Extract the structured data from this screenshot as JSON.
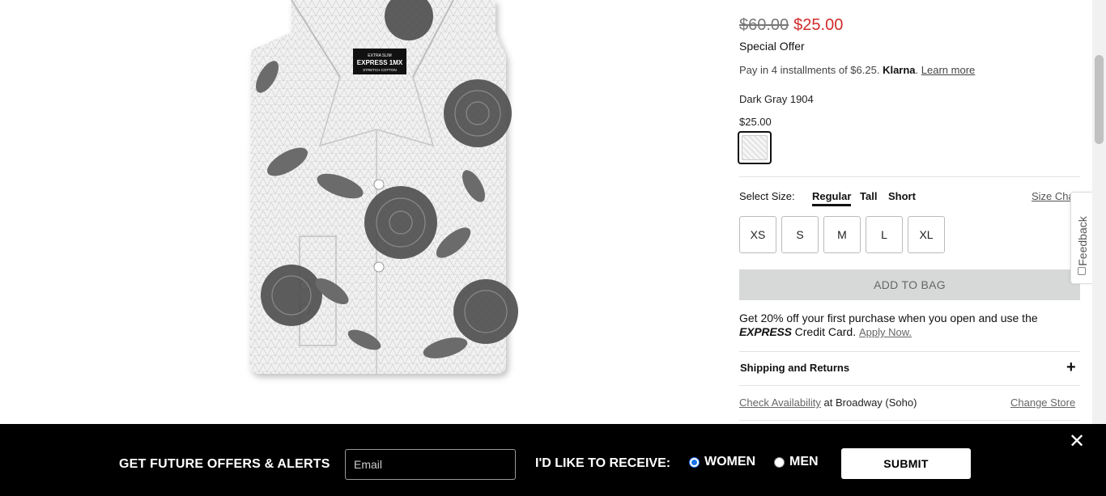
{
  "product": {
    "image_alt": "Extra Slim Floral Print Stretch Cotton 1MX Shirt",
    "label_line1": "EXTRA SLIM",
    "label_brand": "EXPRESS 1MX",
    "label_line3": "STRETCH COTTON"
  },
  "pricing": {
    "original": "$60.00",
    "sale": "$25.00",
    "special": "Special Offer",
    "klarna_prefix": "Pay in 4 installments of $6.25.",
    "klarna_brand": "Klarna",
    "klarna_period": ".",
    "klarna_link": "Learn more"
  },
  "color": {
    "name": "Dark Gray 1904",
    "price": "$25.00"
  },
  "size": {
    "label": "Select Size:",
    "fits": [
      "Regular",
      "Tall",
      "Short"
    ],
    "chart_link": "Size Chart",
    "options": [
      "XS",
      "S",
      "M",
      "L",
      "XL"
    ]
  },
  "actions": {
    "add_to_bag": "ADD TO BAG"
  },
  "promo": {
    "text": "Get 20% off your first purchase when you open and use the",
    "brand": "EXPRESS",
    "text2": "Credit Card.",
    "link": "Apply Now."
  },
  "shipping": {
    "label": "Shipping and Returns",
    "toggle": "+"
  },
  "store": {
    "check_link": "Check Availability",
    "at_text": "at Broadway (Soho)",
    "change_link": "Change Store"
  },
  "feedback": {
    "label": "Feedback"
  },
  "offers": {
    "title": "GET FUTURE OFFERS & ALERTS",
    "email_placeholder": "Email",
    "receive_label": "I'D LIKE TO RECEIVE:",
    "option_women": "WOMEN",
    "option_men": "MEN",
    "selected": "WOMEN",
    "submit": "SUBMIT",
    "close": "✕"
  }
}
